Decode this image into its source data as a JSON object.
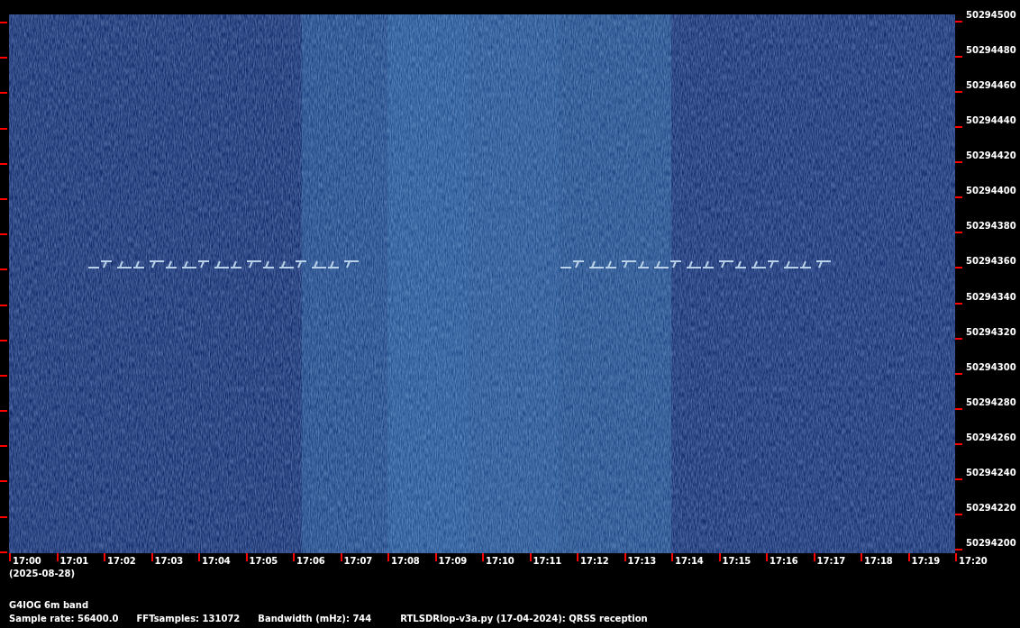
{
  "frequency_axis": {
    "labels": [
      "50294500",
      "50294480",
      "50294460",
      "50294440",
      "50294420",
      "50294400",
      "50294380",
      "50294360",
      "50294340",
      "50294320",
      "50294300",
      "50294280",
      "50294260",
      "50294240",
      "50294220",
      "50294200"
    ]
  },
  "time_axis": {
    "labels": [
      "17:00",
      "17:01",
      "17:02",
      "17:03",
      "17:04",
      "17:05",
      "17:06",
      "17:07",
      "17:08",
      "17:09",
      "17:10",
      "17:11",
      "17:12",
      "17:13",
      "17:14",
      "17:15",
      "17:16",
      "17:17",
      "17:18",
      "17:19",
      "17:20"
    ],
    "date": "(2025-08-28)"
  },
  "footer": {
    "station": "G4IOG 6m band",
    "info": [
      "Sample rate: 56400.0",
      "FFTsamples: 131072",
      "Bandwidth (mHz): 744",
      "RTLSDRlop-v3a.py (17-04-2024): QRSS reception"
    ]
  }
}
